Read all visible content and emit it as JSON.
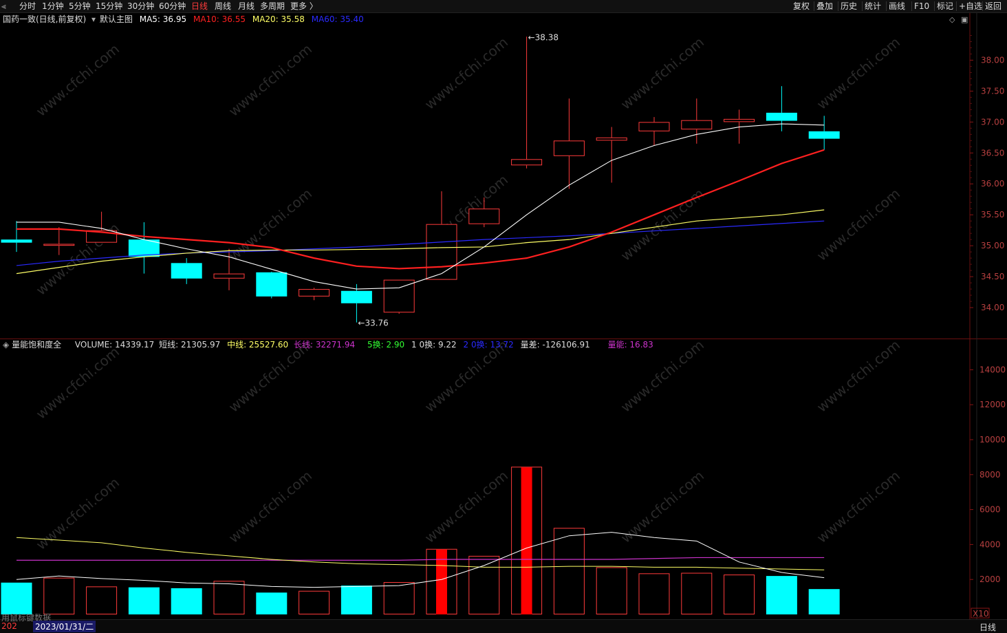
{
  "toolbar": {
    "collapse_icon": "double-chevron-left-icon",
    "periods": [
      "分时",
      "1分钟",
      "5分钟",
      "15分钟",
      "30分钟",
      "60分钟",
      "日线",
      "周线",
      "月线",
      "多周期",
      "更多 〉"
    ],
    "active_index": 6,
    "right_items": [
      "复权",
      "叠加",
      "历史",
      "统计",
      "画线",
      "F10",
      "标记",
      "+自选",
      "返回"
    ]
  },
  "main_legend": {
    "title": "国药一致(日线,前复权)",
    "main_template": "默认主图",
    "ma5_label": "MA5: 36.95",
    "ma10_label": "MA10: 36.55",
    "ma20_label": "MA20: 35.58",
    "ma60_label": "MA60: 35.40"
  },
  "sub_legend": {
    "title": "量能饱和度全",
    "volume_label": "VOLUME: 14339.17",
    "short_label": "短线: 21305.97",
    "mid_label": "中线: 25527.60",
    "long_label": "长线: 32271.94",
    "turn5_label": "5换: 2.90",
    "turn10_label": "1 0换: 9.22",
    "turn20_label": "2 0换: 13.72",
    "diff_label": "量差: -126106.91",
    "energy_label": "量能: 16.83"
  },
  "price_axis": [
    "38.00",
    "37.50",
    "37.00",
    "36.50",
    "36.00",
    "35.50",
    "35.00",
    "34.50",
    "34.00"
  ],
  "volume_axis": [
    "14000",
    "12000",
    "10000",
    "8000",
    "6000",
    "4000",
    "2000"
  ],
  "unit_label": "X10",
  "max_marker": "38.38",
  "min_marker": "33.76",
  "bottom": {
    "left_text": "用鼠标键数据",
    "year_text": "202",
    "date_text": "2023/01/31/二",
    "period_text": "日线"
  },
  "watermark": "www.cfchi.com",
  "colors": {
    "up": "#ff3b3b",
    "down": "#00ffff",
    "ma5": "#ffffff",
    "ma10": "#ff2020",
    "ma20": "#ffff66",
    "ma60": "#2a2aff",
    "long": "#cc33cc"
  },
  "chart_data": {
    "type": "candlestick",
    "candles": [
      {
        "o": 35.1,
        "c": 35.05,
        "h": 35.4,
        "l": 34.9
      },
      {
        "o": 35.0,
        "c": 35.03,
        "h": 35.3,
        "l": 34.85
      },
      {
        "o": 35.05,
        "c": 35.25,
        "h": 35.55,
        "l": 35.05
      },
      {
        "o": 35.1,
        "c": 34.82,
        "h": 35.38,
        "l": 34.55
      },
      {
        "o": 34.72,
        "c": 34.47,
        "h": 34.8,
        "l": 34.38
      },
      {
        "o": 34.47,
        "c": 34.55,
        "h": 34.95,
        "l": 34.28
      },
      {
        "o": 34.57,
        "c": 34.18,
        "h": 34.58,
        "l": 34.15
      },
      {
        "o": 34.18,
        "c": 34.3,
        "h": 34.32,
        "l": 34.12
      },
      {
        "o": 34.27,
        "c": 34.07,
        "h": 34.38,
        "l": 33.76
      },
      {
        "o": 33.92,
        "c": 34.45,
        "h": 34.45,
        "l": 33.9
      },
      {
        "o": 34.45,
        "c": 35.35,
        "h": 35.88,
        "l": 34.45
      },
      {
        "o": 35.35,
        "c": 35.6,
        "h": 35.78,
        "l": 35.3
      },
      {
        "o": 36.3,
        "c": 36.4,
        "h": 38.38,
        "l": 36.25
      },
      {
        "o": 36.45,
        "c": 36.7,
        "h": 37.38,
        "l": 35.92
      },
      {
        "o": 36.7,
        "c": 36.75,
        "h": 36.92,
        "l": 36.02
      },
      {
        "o": 36.85,
        "c": 37.0,
        "h": 37.08,
        "l": 36.62
      },
      {
        "o": 36.88,
        "c": 37.03,
        "h": 37.38,
        "l": 36.65
      },
      {
        "o": 37.0,
        "c": 37.05,
        "h": 37.2,
        "l": 36.65
      },
      {
        "o": 37.15,
        "c": 37.02,
        "h": 37.58,
        "l": 36.85
      },
      {
        "o": 36.85,
        "c": 36.73,
        "h": 37.1,
        "l": 36.55
      }
    ],
    "ma5": [
      35.38,
      35.38,
      35.28,
      35.1,
      34.95,
      34.82,
      34.62,
      34.42,
      34.3,
      34.32,
      34.55,
      34.98,
      35.5,
      35.98,
      36.38,
      36.62,
      36.8,
      36.92,
      36.97,
      36.95
    ],
    "ma10": [
      35.27,
      35.27,
      35.22,
      35.15,
      35.1,
      35.05,
      34.97,
      34.8,
      34.67,
      34.63,
      34.66,
      34.72,
      34.8,
      34.98,
      35.22,
      35.5,
      35.78,
      36.05,
      36.33,
      36.55
    ],
    "ma20": [
      34.55,
      34.65,
      34.75,
      34.82,
      34.88,
      34.92,
      34.93,
      34.93,
      34.94,
      34.95,
      34.97,
      34.98,
      35.05,
      35.1,
      35.2,
      35.3,
      35.4,
      35.45,
      35.5,
      35.58
    ],
    "ma60": [
      34.68,
      34.75,
      34.8,
      34.85,
      34.88,
      34.9,
      34.92,
      34.95,
      34.98,
      35.02,
      35.06,
      35.1,
      35.13,
      35.16,
      35.2,
      35.24,
      35.28,
      35.32,
      35.36,
      35.4
    ],
    "volume": [
      1820,
      2100,
      1600,
      1550,
      1500,
      1920,
      1250,
      1350,
      1650,
      1850,
      3750,
      3350,
      8450,
      4950,
      2700,
      2350,
      2380,
      2280,
      2200,
      1450
    ],
    "volume_dir": [
      "down",
      "up",
      "up",
      "down",
      "down",
      "up",
      "down",
      "up",
      "down",
      "up",
      "up",
      "up",
      "up",
      "up",
      "up",
      "up",
      "up",
      "up",
      "down",
      "down"
    ],
    "emphasis": [
      false,
      false,
      false,
      false,
      false,
      false,
      false,
      false,
      false,
      false,
      true,
      false,
      true,
      false,
      false,
      false,
      false,
      false,
      false,
      false
    ],
    "vol_short": [
      2000,
      2200,
      2050,
      1950,
      1800,
      1750,
      1600,
      1550,
      1600,
      1650,
      2000,
      2800,
      3800,
      4500,
      4700,
      4400,
      4200,
      3000,
      2400,
      2100
    ],
    "vol_mid": [
      4400,
      4250,
      4100,
      3800,
      3550,
      3350,
      3150,
      3000,
      2900,
      2850,
      2800,
      2700,
      2700,
      2750,
      2750,
      2700,
      2700,
      2650,
      2600,
      2550
    ],
    "vol_long": [
      3100,
      3100,
      3100,
      3100,
      3100,
      3100,
      3100,
      3100,
      3100,
      3100,
      3150,
      3150,
      3150,
      3150,
      3150,
      3200,
      3250,
      3250,
      3250,
      3250
    ],
    "price_range": [
      33.5,
      38.55
    ],
    "volume_range": [
      0,
      15000
    ]
  }
}
